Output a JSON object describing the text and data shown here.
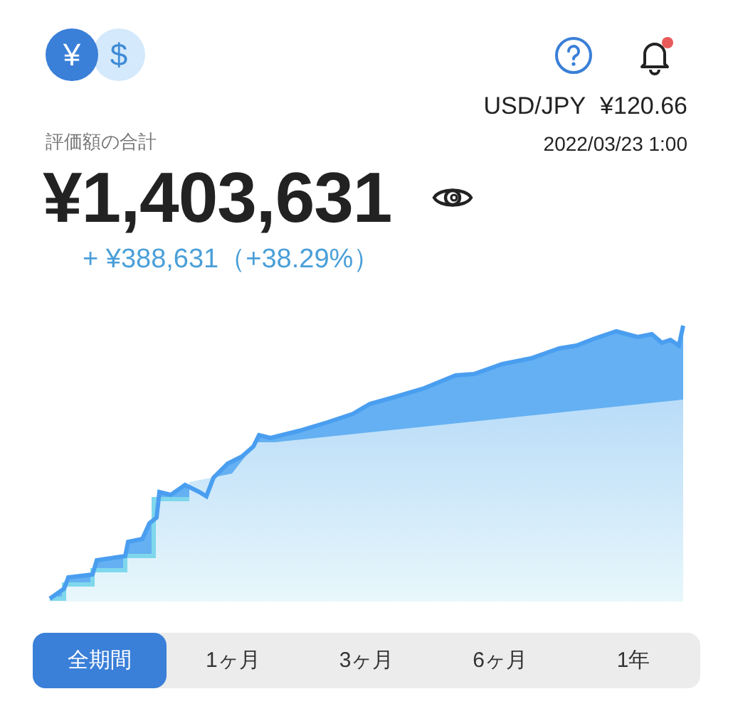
{
  "currencies": [
    {
      "symbol": "¥",
      "selected": true
    },
    {
      "symbol": "$",
      "selected": false
    }
  ],
  "notifications": {
    "unread": true
  },
  "rate": {
    "pair": "USD/JPY",
    "value": "¥120.66",
    "time": "2022/03/23 1:00"
  },
  "total": {
    "label": "評価額の合計",
    "amount": "¥1,403,631",
    "change": "+ ¥388,631（+38.29%）"
  },
  "periods": [
    {
      "label": "全期間",
      "selected": true
    },
    {
      "label": "1ヶ月",
      "selected": false
    },
    {
      "label": "3ヶ月",
      "selected": false
    },
    {
      "label": "6ヶ月",
      "selected": false
    },
    {
      "label": "1年",
      "selected": false
    }
  ]
}
